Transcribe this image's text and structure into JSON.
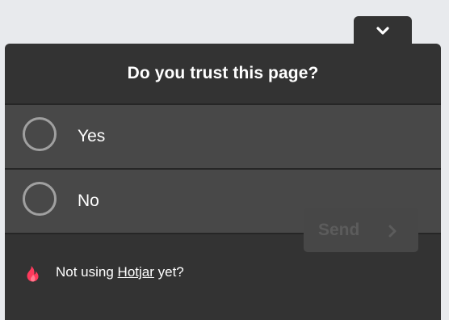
{
  "survey": {
    "question": "Do you trust this page?",
    "options": [
      {
        "label": "Yes",
        "selected": false
      },
      {
        "label": "No",
        "selected": false
      }
    ]
  },
  "footer": {
    "promo_prefix": "Not using ",
    "promo_link": "Hotjar",
    "promo_suffix": " yet?",
    "send_label": "Send"
  },
  "icons": {
    "collapse": "chevron-down-icon",
    "brand": "hotjar-flame-icon",
    "send_arrow": "chevron-right-icon"
  },
  "colors": {
    "panel": "#333333",
    "option_bg": "#484848",
    "brand_accent": "#fd3a5c",
    "send_disabled_text": "#5c5c5c"
  }
}
